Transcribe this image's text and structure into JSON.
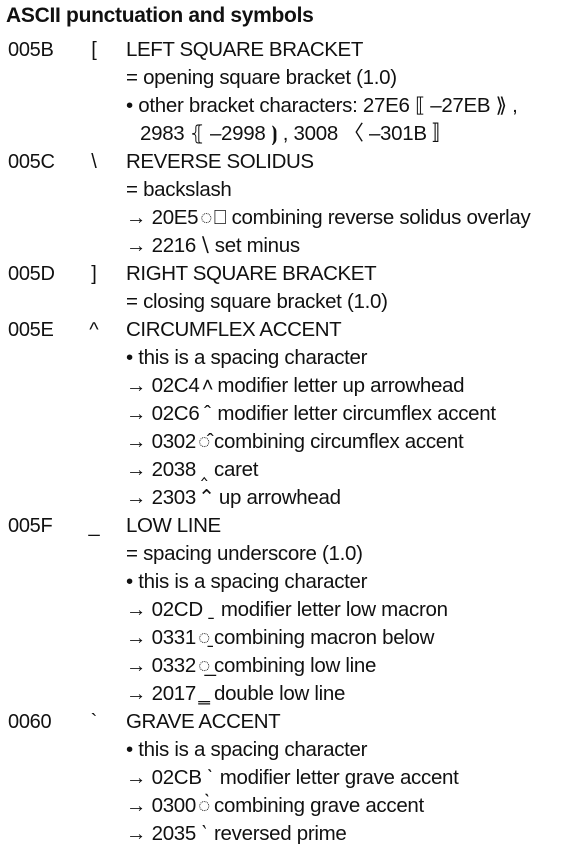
{
  "title": "ASCII punctuation and symbols",
  "entries": [
    {
      "code": "005B",
      "glyph": "[",
      "name": "LEFT SQUARE BRACKET",
      "notes": [
        {
          "type": "alias",
          "text": "= opening square bracket (1.0)"
        },
        {
          "type": "bullet",
          "text": "• other bracket characters: 27E6 ⟦ –27EB ⟫ ,"
        },
        {
          "type": "continuation",
          "text": "2983 ⦃ –2998 ⦘ , 3008 〈 –301B 〛"
        }
      ]
    },
    {
      "code": "005C",
      "glyph": "\\",
      "name": "REVERSE SOLIDUS",
      "notes": [
        {
          "type": "alias",
          "text": "= backslash"
        },
        {
          "type": "xref",
          "arrow": "→",
          "code": "20E5",
          "sym": "◌⃥",
          "desc": "combining reverse solidus overlay"
        },
        {
          "type": "xref",
          "arrow": "→",
          "code": "2216",
          "sym": "∖",
          "desc": "set minus"
        }
      ]
    },
    {
      "code": "005D",
      "glyph": "]",
      "name": "RIGHT SQUARE BRACKET",
      "notes": [
        {
          "type": "alias",
          "text": "= closing square bracket (1.0)"
        }
      ]
    },
    {
      "code": "005E",
      "glyph": "^",
      "name": "CIRCUMFLEX ACCENT",
      "notes": [
        {
          "type": "bullet",
          "text": "• this is a spacing character"
        },
        {
          "type": "xref",
          "arrow": "→",
          "code": "02C4",
          "sym": "˄",
          "desc": "modifier letter up arrowhead"
        },
        {
          "type": "xref",
          "arrow": "→",
          "code": "02C6",
          "sym": "ˆ",
          "desc": "modifier letter circumflex accent"
        },
        {
          "type": "xref",
          "arrow": "→",
          "code": "0302",
          "sym": "◌̂",
          "desc": "combining circumflex accent"
        },
        {
          "type": "xref",
          "arrow": "→",
          "code": "2038",
          "sym": "‸",
          "desc": "caret"
        },
        {
          "type": "xref",
          "arrow": "→",
          "code": "2303",
          "sym": "⌃",
          "desc": "up arrowhead"
        }
      ]
    },
    {
      "code": "005F",
      "glyph": "_",
      "name": "LOW LINE",
      "notes": [
        {
          "type": "alias",
          "text": "= spacing underscore (1.0)"
        },
        {
          "type": "bullet",
          "text": "• this is a spacing character"
        },
        {
          "type": "xref",
          "arrow": "→",
          "code": "02CD",
          "sym": "ˍ",
          "desc": "modifier letter low macron"
        },
        {
          "type": "xref",
          "arrow": "→",
          "code": "0331",
          "sym": "◌̱",
          "desc": "combining macron below"
        },
        {
          "type": "xref",
          "arrow": "→",
          "code": "0332",
          "sym": "◌̲",
          "desc": "combining low line"
        },
        {
          "type": "xref",
          "arrow": "→",
          "code": "2017",
          "sym": "‗",
          "desc": "double low line"
        }
      ]
    },
    {
      "code": "0060",
      "glyph": "`",
      "name": "GRAVE ACCENT",
      "notes": [
        {
          "type": "bullet",
          "text": "• this is a spacing character"
        },
        {
          "type": "xref",
          "arrow": "→",
          "code": "02CB",
          "sym": "ˋ",
          "desc": "modifier letter grave accent"
        },
        {
          "type": "xref",
          "arrow": "→",
          "code": "0300",
          "sym": "◌̀",
          "desc": "combining grave accent"
        },
        {
          "type": "xref",
          "arrow": "→",
          "code": "2035",
          "sym": "‵",
          "desc": "reversed prime"
        }
      ]
    }
  ]
}
